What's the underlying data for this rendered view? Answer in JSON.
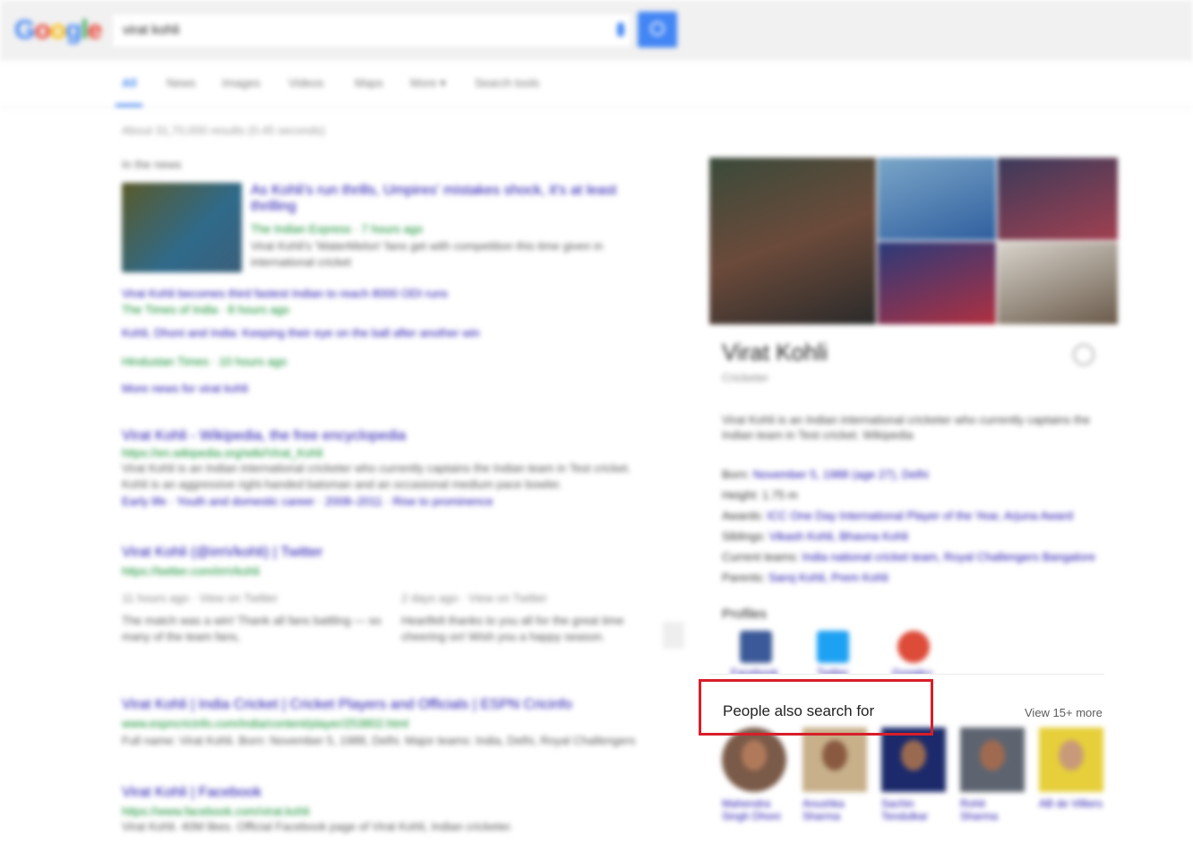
{
  "header": {
    "logo": [
      "G",
      "o",
      "o",
      "g",
      "l",
      "e"
    ],
    "query": "virat kohli"
  },
  "tabs": [
    {
      "label": "All",
      "active": true
    },
    {
      "label": "News"
    },
    {
      "label": "Images"
    },
    {
      "label": "Videos"
    },
    {
      "label": "Maps"
    },
    {
      "label": "More ▾"
    },
    {
      "label": "Search tools"
    }
  ],
  "stats": "About 31,70,000 results (0.45 seconds)",
  "results": {
    "top_stories_label": "In the news",
    "news_title": "As Kohli's run thrills, Umpires' mistakes shock, it's at least thrilling",
    "news_source": "The Indian Express · 7 hours ago",
    "news_snippet": "Virat Kohli's 'WaterMelon' fans get with competition this time given in international cricket",
    "news2_title": "Virat Kohli becomes third fastest Indian to reach 8000 ODI runs",
    "news2_source": "The Times of India · 8 hours ago",
    "news3_title": "Kohli, Dhoni and India: Keeping their eye on the ball after another win",
    "news3_source": "Hindustan Times · 10 hours ago",
    "more_news": "More news for virat kohli",
    "wiki_title": "Virat Kohli - Wikipedia, the free encyclopedia",
    "wiki_url": "https://en.wikipedia.org/wiki/Virat_Kohli",
    "wiki_snippet": "Virat Kohli is an Indian international cricketer who currently captains the Indian team in Test cricket. Kohli is an aggressive right-handed batsman and an occasional medium pace bowler.",
    "wiki_links": "Early life · Youth and domestic career · 2008–2011 · Rise to prominence",
    "tw_title": "Virat Kohli (@imVkohli) | Twitter",
    "tw_url": "https://twitter.com/imVkohli",
    "tw_time1": "11 hours ago · View on Twitter",
    "tw_time2": "2 days ago · View on Twitter",
    "tw_snip1": "The match was a win! Thank all fans battling — so many of the team fans,",
    "tw_snip2": "Heartfelt thanks to you all for the great time cheering on! Wish you a happy season.",
    "espn_title": "Virat Kohli | India Cricket | Cricket Players and Officials | ESPN Cricinfo",
    "espn_url": "www.espncricinfo.com/india/content/player/253802.html",
    "espn_snippet": "Full name: Virat Kohli. Born: November 5, 1988, Delhi. Major teams: India, Delhi, Royal Challengers",
    "fb_title": "Virat Kohli | Facebook",
    "fb_url": "https://www.facebook.com/virat.kohli",
    "fb_snippet": "Virat Kohli. 40M likes. Official Facebook page of Virat Kohli, Indian cricketer."
  },
  "knowledge_panel": {
    "name": "Virat Kohli",
    "subtitle": "Cricketer",
    "description": "Virat Kohli is an Indian international cricketer who currently captains the Indian team in Test cricket. Wikipedia",
    "facts": [
      {
        "k": "Born:",
        "v": "November 5, 1988 (age 27), Delhi"
      },
      {
        "k": "Height:",
        "v": "1.75 m"
      },
      {
        "k": "Awards:",
        "v": "ICC One Day International Player of the Year, Arjuna Award"
      },
      {
        "k": "Siblings:",
        "v": "Vikash Kohli, Bhavna Kohli"
      },
      {
        "k": "Current teams:",
        "v": "India national cricket team, Royal Challengers Bangalore"
      },
      {
        "k": "Parents:",
        "v": "Saroj Kohli, Prem Kohli"
      }
    ],
    "profiles_heading": "Profiles",
    "profiles": [
      {
        "label": "Facebook",
        "color": "#3b5998"
      },
      {
        "label": "Twitter",
        "color": "#1da1f2"
      },
      {
        "label": "Google+",
        "color": "#dd4b39"
      }
    ]
  },
  "people_also_search": {
    "heading": "People also search for",
    "view_more": "View 15+ more",
    "people": [
      {
        "name": "Mahendra Singh Dhoni",
        "bg": "#7a5a48"
      },
      {
        "name": "Anushka Sharma",
        "bg": "#c7b08a"
      },
      {
        "name": "Sachin Tendulkar",
        "bg": "#1c2a6b"
      },
      {
        "name": "Rohit Sharma",
        "bg": "#5d6470"
      },
      {
        "name": "AB de Villiers",
        "bg": "#e6cf3a"
      }
    ]
  },
  "colors": {
    "highlight": "#d81e2a",
    "link": "#1a0dab",
    "accent": "#4285f4"
  }
}
